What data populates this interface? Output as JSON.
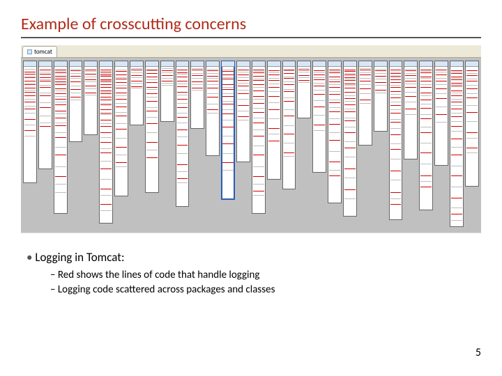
{
  "title": "Example of crosscutting concerns",
  "tab_label": "tomcat",
  "columns": [
    {
      "height_pct": 72,
      "red_at": [
        4,
        6,
        9,
        12,
        15,
        18,
        22,
        25,
        30,
        36,
        45,
        55
      ],
      "grey_at": [
        2,
        8,
        14,
        20,
        28,
        34,
        40,
        50,
        60
      ]
    },
    {
      "height_pct": 64,
      "red_at": [
        3,
        7,
        10,
        14,
        20,
        28,
        40,
        58
      ],
      "grey_at": [
        5,
        12,
        18,
        25,
        35,
        48,
        55
      ]
    },
    {
      "height_pct": 90,
      "red_at": [
        2,
        4,
        6,
        8,
        10,
        12,
        15,
        18,
        22,
        26,
        30,
        35,
        40,
        48,
        60,
        75
      ],
      "grey_at": [
        3,
        7,
        11,
        16,
        20,
        24,
        32,
        38,
        45,
        55,
        68,
        80,
        86
      ]
    },
    {
      "height_pct": 48,
      "red_at": [
        5,
        12,
        20,
        30,
        40
      ],
      "grey_at": [
        3,
        8,
        15,
        25,
        35,
        44
      ]
    },
    {
      "height_pct": 44,
      "red_at": [
        4,
        10,
        18,
        28,
        38
      ],
      "grey_at": [
        6,
        14,
        22,
        32,
        41
      ]
    },
    {
      "height_pct": 96,
      "red_at": [
        2,
        3,
        5,
        6,
        8,
        9,
        11,
        13,
        15,
        17,
        19,
        21,
        24,
        27,
        30,
        34,
        38,
        42,
        48,
        55,
        65,
        78,
        88
      ],
      "grey_at": [
        4,
        10,
        16,
        23,
        29,
        36,
        45,
        52,
        60,
        72,
        82,
        92
      ]
    },
    {
      "height_pct": 80,
      "red_at": [
        3,
        6,
        9,
        12,
        16,
        20,
        25,
        31,
        38,
        48,
        62,
        74
      ],
      "grey_at": [
        2,
        8,
        14,
        22,
        28,
        35,
        44,
        55,
        68,
        77
      ]
    },
    {
      "height_pct": 38,
      "red_at": [
        5,
        14,
        24,
        34
      ],
      "grey_at": [
        3,
        10,
        18,
        28,
        36
      ]
    },
    {
      "height_pct": 78,
      "red_at": [
        2,
        5,
        8,
        12,
        16,
        21,
        27,
        35,
        45,
        60,
        72
      ],
      "grey_at": [
        3,
        10,
        18,
        24,
        32,
        40,
        52,
        66
      ]
    },
    {
      "height_pct": 36,
      "red_at": [
        6,
        16,
        26
      ],
      "grey_at": [
        3,
        10,
        20,
        30,
        34
      ]
    },
    {
      "height_pct": 86,
      "red_at": [
        2,
        4,
        7,
        10,
        14,
        18,
        23,
        29,
        36,
        45,
        56,
        70,
        80
      ],
      "grey_at": [
        5,
        12,
        20,
        26,
        33,
        40,
        50,
        62,
        75,
        83
      ]
    },
    {
      "height_pct": 40,
      "red_at": [
        5,
        14,
        24,
        34
      ],
      "grey_at": [
        2,
        10,
        18,
        28,
        38
      ]
    },
    {
      "height_pct": 56,
      "red_at": [
        4,
        10,
        16,
        24,
        34,
        48
      ],
      "grey_at": [
        2,
        7,
        13,
        20,
        30,
        42,
        52
      ]
    },
    {
      "height_pct": 82,
      "red_at": [
        3,
        6,
        9,
        13,
        17,
        22,
        28,
        35,
        45,
        58,
        72
      ],
      "grey_at": [
        2,
        8,
        15,
        20,
        26,
        32,
        40,
        52,
        65,
        78
      ],
      "selected": true
    },
    {
      "height_pct": 60,
      "red_at": [
        3,
        8,
        14,
        20,
        28,
        40,
        52
      ],
      "grey_at": [
        5,
        11,
        17,
        24,
        34,
        46,
        56
      ]
    },
    {
      "height_pct": 90,
      "red_at": [
        2,
        4,
        6,
        9,
        12,
        16,
        20,
        25,
        31,
        38,
        47,
        60,
        75,
        85
      ],
      "grey_at": [
        3,
        8,
        14,
        22,
        28,
        35,
        43,
        54,
        68,
        80,
        88
      ]
    },
    {
      "height_pct": 70,
      "red_at": [
        3,
        7,
        12,
        18,
        26,
        38,
        55,
        66
      ],
      "grey_at": [
        5,
        10,
        15,
        22,
        32,
        46,
        60
      ]
    },
    {
      "height_pct": 76,
      "red_at": [
        2,
        5,
        9,
        14,
        20,
        28,
        40,
        55,
        70
      ],
      "grey_at": [
        3,
        8,
        12,
        18,
        25,
        35,
        48,
        62,
        73
      ]
    },
    {
      "height_pct": 34,
      "red_at": [
        6,
        16,
        26
      ],
      "grey_at": [
        3,
        10,
        20,
        30
      ]
    },
    {
      "height_pct": 66,
      "red_at": [
        3,
        7,
        12,
        18,
        26,
        38,
        55
      ],
      "grey_at": [
        5,
        10,
        15,
        22,
        32,
        46,
        60
      ]
    },
    {
      "height_pct": 84,
      "red_at": [
        2,
        4,
        7,
        11,
        15,
        20,
        26,
        33,
        42,
        54,
        70,
        80
      ],
      "grey_at": [
        3,
        9,
        13,
        18,
        24,
        30,
        38,
        48,
        62,
        76
      ]
    },
    {
      "height_pct": 92,
      "red_at": [
        2,
        3,
        5,
        7,
        9,
        11,
        14,
        17,
        21,
        25,
        30,
        36,
        44,
        54,
        68,
        82
      ],
      "grey_at": [
        4,
        8,
        12,
        19,
        23,
        28,
        34,
        40,
        50,
        60,
        74,
        88
      ]
    },
    {
      "height_pct": 50,
      "red_at": [
        4,
        10,
        18,
        28,
        42
      ],
      "grey_at": [
        2,
        7,
        14,
        22,
        34,
        46
      ]
    },
    {
      "height_pct": 42,
      "red_at": [
        5,
        14,
        24,
        36
      ],
      "grey_at": [
        3,
        10,
        18,
        28,
        40
      ]
    },
    {
      "height_pct": 94,
      "red_at": [
        2,
        4,
        6,
        8,
        10,
        13,
        16,
        20,
        25,
        30,
        36,
        44,
        54,
        68,
        82,
        90
      ],
      "grey_at": [
        3,
        7,
        12,
        18,
        23,
        28,
        34,
        40,
        50,
        60,
        74,
        86
      ]
    },
    {
      "height_pct": 58,
      "red_at": [
        4,
        9,
        15,
        22,
        32,
        46
      ],
      "grey_at": [
        2,
        7,
        12,
        18,
        27,
        38,
        52
      ]
    },
    {
      "height_pct": 88,
      "red_at": [
        2,
        4,
        7,
        10,
        14,
        18,
        23,
        29,
        36,
        46,
        60,
        76,
        84
      ],
      "grey_at": [
        3,
        8,
        12,
        20,
        26,
        33,
        42,
        53,
        68,
        80
      ]
    },
    {
      "height_pct": 62,
      "red_at": [
        3,
        8,
        14,
        22,
        32,
        48
      ],
      "grey_at": [
        5,
        11,
        18,
        27,
        40,
        56
      ]
    },
    {
      "height_pct": 98,
      "red_at": [
        2,
        4,
        6,
        8,
        10,
        12,
        15,
        18,
        22,
        26,
        31,
        37,
        45,
        55,
        68,
        82,
        92
      ],
      "grey_at": [
        3,
        7,
        11,
        16,
        20,
        24,
        29,
        34,
        40,
        50,
        62,
        75,
        88,
        96
      ]
    },
    {
      "height_pct": 74,
      "red_at": [
        3,
        7,
        12,
        18,
        26,
        38,
        55,
        68
      ],
      "grey_at": [
        5,
        10,
        15,
        22,
        32,
        46,
        60,
        72
      ]
    }
  ],
  "bullet_main": "Logging in Tomcat:",
  "bullet_sub1": "Red shows the lines of code that handle logging",
  "bullet_sub2": "Logging code scattered across packages and classes",
  "page_number": "5"
}
